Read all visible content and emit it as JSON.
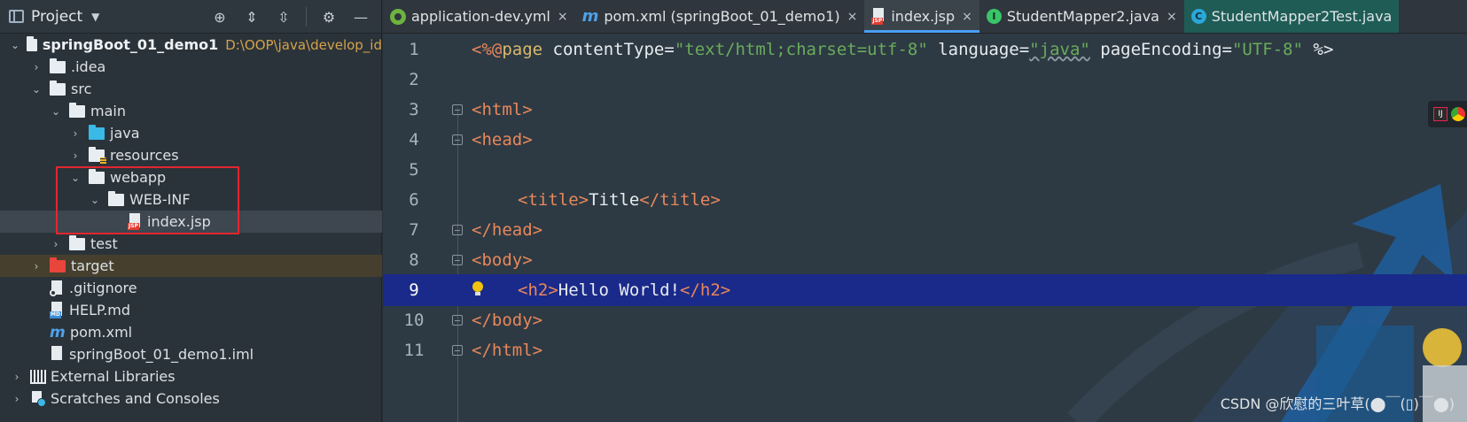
{
  "project_panel": {
    "title": "Project",
    "caret": "▼",
    "tools": {
      "locate": "⊕",
      "expand": "⇕",
      "collapse": "⇳",
      "settings": "⚙",
      "hide": "—"
    },
    "tree": {
      "root": {
        "label": "springBoot_01_demo1",
        "path": "D:\\OOP\\java\\develop_id"
      },
      "idea": ".idea",
      "src": "src",
      "main": "main",
      "java": "java",
      "resources": "resources",
      "webapp": "webapp",
      "web_inf": "WEB-INF",
      "index_jsp": "index.jsp",
      "test": "test",
      "target": "target",
      "gitignore": ".gitignore",
      "help_md": "HELP.md",
      "pom_xml": "pom.xml",
      "iml": "springBoot_01_demo1.iml",
      "external_libraries": "External Libraries",
      "scratches": "Scratches and Consoles"
    },
    "icon_tags": {
      "jsp": "JSP",
      "md": "MD"
    }
  },
  "tabs": [
    {
      "label": "application-dev.yml"
    },
    {
      "label": "pom.xml (springBoot_01_demo1)"
    },
    {
      "label": "index.jsp"
    },
    {
      "label": "StudentMapper2.java"
    },
    {
      "label": "StudentMapper2Test.java"
    }
  ],
  "tab_icons": {
    "mvn": "m",
    "jsp": "JSP",
    "iface": "I",
    "cls": "C"
  },
  "tab_close": "×",
  "editor": {
    "current_line": 9,
    "line_numbers": [
      "1",
      "2",
      "3",
      "4",
      "5",
      "6",
      "7",
      "8",
      "9",
      "10",
      "11"
    ],
    "line1": {
      "p1": "<%@",
      "p2": "page",
      "p3": " contentType=",
      "p4": "\"text/html;charset=utf-8\"",
      "p5": " language=",
      "p6": "\"java\"",
      "p7": " pageEncoding=",
      "p8": "\"UTF-8\"",
      "p9": " %>"
    },
    "line3": "<html>",
    "line4": "<head>",
    "line6": {
      "open": "<title>",
      "text": "Title",
      "close": "</title>"
    },
    "line7": "</head>",
    "line8": "<body>",
    "line9": {
      "open": "<h2>",
      "text": "Hello World!",
      "close": "</h2>"
    },
    "line10": "</body>",
    "line11": "</html>"
  },
  "watermark": "CSDN @欣慰的三叶草(⬤￣(▯)￣⬤)",
  "colors": {
    "tag": "#e8875a",
    "string": "#6aab5a",
    "current_line_bg": "#1a2a8a",
    "highlight_box": "#e3262f",
    "active_tab_underline": "#4a9ff5"
  }
}
